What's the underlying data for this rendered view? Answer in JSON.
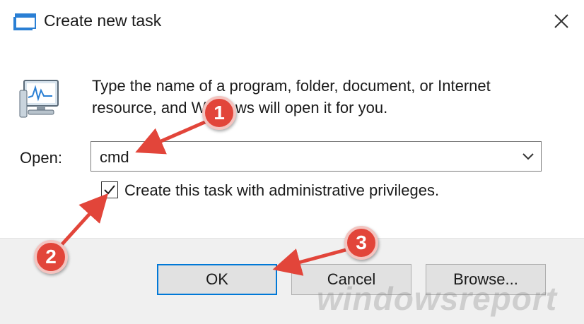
{
  "window": {
    "title": "Create new task",
    "close_icon": "close-icon",
    "app_icon": "task-window-icon"
  },
  "dialog": {
    "description": "Type the name of a program, folder, document, or Internet resource, and Windows will open it for you.",
    "open_label": "Open:",
    "open_value": "cmd",
    "admin_checkbox_label": "Create this task with administrative privileges.",
    "admin_checked": true
  },
  "buttons": {
    "ok": "OK",
    "cancel": "Cancel",
    "browse": "Browse..."
  },
  "annotations": {
    "step1": "1",
    "step2": "2",
    "step3": "3",
    "color": "#e2453a"
  },
  "watermark": "windowsreport",
  "colors": {
    "focus_border": "#0078d7",
    "footer_bg": "#f0f0f0",
    "button_bg": "#e1e1e1"
  }
}
